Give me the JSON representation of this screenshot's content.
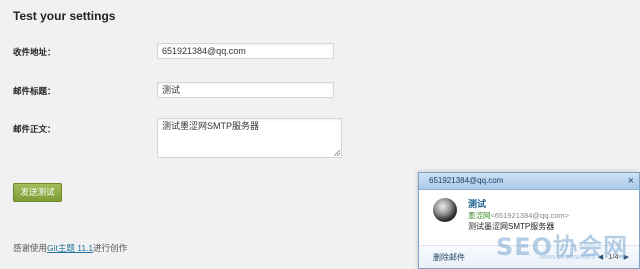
{
  "page": {
    "title": "Test your settings"
  },
  "form": {
    "recipient_label": "收件地址：",
    "recipient_value": "651921384@qq.com",
    "subject_label": "邮件标题：",
    "subject_value": "测试",
    "body_label": "邮件正文：",
    "body_value": "测试墨涩网SMTP服务器",
    "send_label": "发送测试"
  },
  "footer": {
    "prefix": "感谢使用",
    "link_text": "Git主题 11.1",
    "suffix": "进行创作"
  },
  "notification": {
    "from_email": "651921384@qq.com",
    "close_glyph": "×",
    "subject": "测试",
    "sender_name": "墨涩网",
    "sender_email": "<651921384@qq.com>",
    "preview": "测试墨涩网SMTP服务器",
    "delete_label": "删除邮件",
    "prev_glyph": "◀",
    "counter": "1/4",
    "next_glyph": "▶"
  },
  "watermark": {
    "text": "SEO协会网",
    "sub": "www.seoxhw.com"
  },
  "colors": {
    "button_green": "#7f9b33",
    "link_blue": "#21759b",
    "popup_border": "#7ea3c9"
  }
}
